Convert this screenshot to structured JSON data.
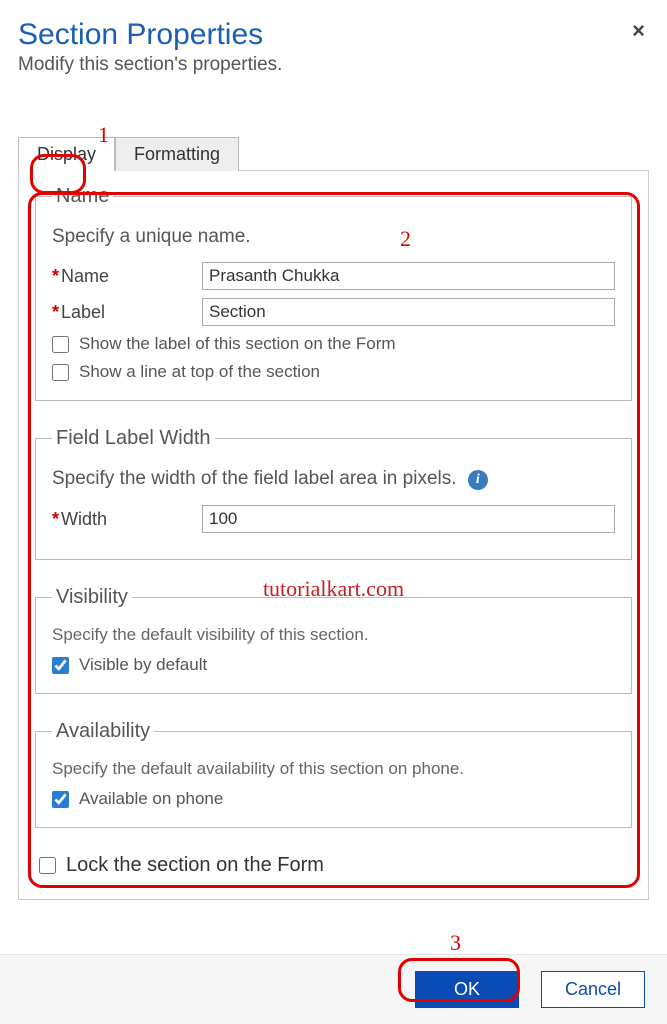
{
  "dialog": {
    "title": "Section Properties",
    "subtitle": "Modify this section's properties."
  },
  "tabs": {
    "display": "Display",
    "formatting": "Formatting"
  },
  "name_group": {
    "legend": "Name",
    "desc": "Specify a unique name.",
    "name_label": "Name",
    "name_value": "Prasanth Chukka",
    "label_label": "Label",
    "label_value": "Section",
    "show_label_text": "Show the label of this section on the Form",
    "show_line_text": "Show a line at top of the section"
  },
  "width_group": {
    "legend": "Field Label Width",
    "desc": "Specify the width of the field label area in pixels.",
    "width_label": "Width",
    "width_value": "100"
  },
  "visibility_group": {
    "legend": "Visibility",
    "desc": "Specify the default visibility of this section.",
    "visible_label": "Visible by default"
  },
  "availability_group": {
    "legend": "Availability",
    "desc": "Specify the default availability of this section on phone.",
    "available_label": "Available on phone"
  },
  "lock": {
    "label": "Lock the section on the Form"
  },
  "buttons": {
    "ok": "OK",
    "cancel": "Cancel"
  },
  "annotations": {
    "n1": "1",
    "n2": "2",
    "n3": "3",
    "watermark": "tutorialkart.com"
  }
}
